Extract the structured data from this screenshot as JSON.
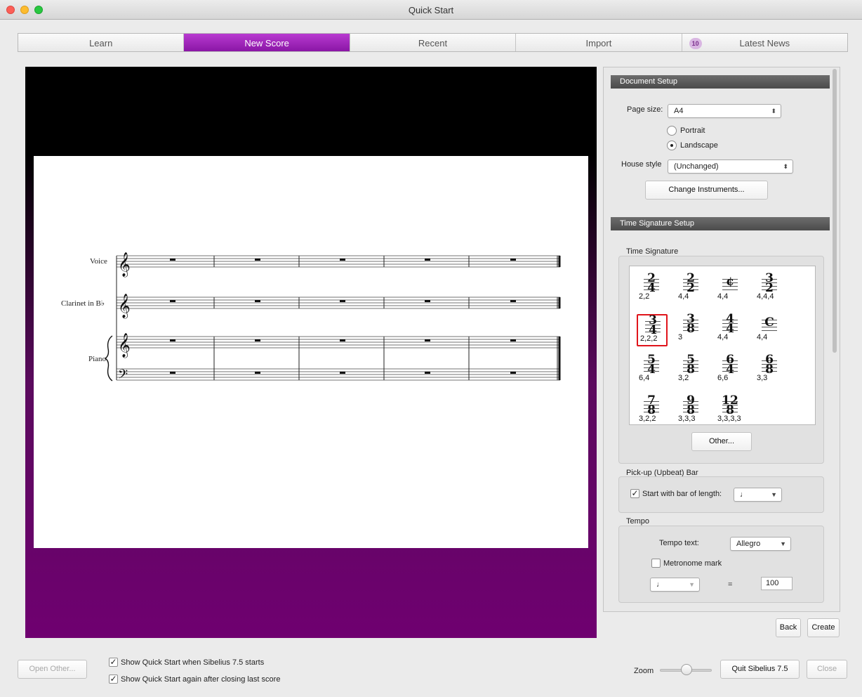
{
  "window": {
    "title": "Quick Start"
  },
  "tabs": [
    {
      "label": "Learn"
    },
    {
      "label": "New Score"
    },
    {
      "label": "Recent"
    },
    {
      "label": "Import"
    },
    {
      "label": "Latest News",
      "badge": "10"
    }
  ],
  "score": {
    "instruments": [
      "Voice",
      "Clarinet in B♭",
      "Piano"
    ]
  },
  "document_setup": {
    "heading": "Document Setup",
    "page_size_label": "Page size:",
    "page_size_value": "A4",
    "portrait_label": "Portrait",
    "landscape_label": "Landscape",
    "orientation_selected": "Landscape",
    "house_style_label": "House style",
    "house_style_value": "(Unchanged)",
    "change_instruments_label": "Change Instruments..."
  },
  "time_signature_setup": {
    "heading": "Time Signature Setup",
    "group_label": "Time Signature",
    "options": [
      {
        "num": "2",
        "den": "4",
        "beats": "2,2"
      },
      {
        "num": "2",
        "den": "2",
        "beats": "4,4"
      },
      {
        "num": "¢",
        "den": "",
        "beats": "4,4"
      },
      {
        "num": "3",
        "den": "2",
        "beats": "4,4,4"
      },
      {
        "num": "3",
        "den": "4",
        "beats": "2,2,2",
        "selected": true
      },
      {
        "num": "3",
        "den": "8",
        "beats": "3"
      },
      {
        "num": "4",
        "den": "4",
        "beats": "4,4"
      },
      {
        "num": "C",
        "den": "",
        "beats": "4,4"
      },
      {
        "num": "5",
        "den": "4",
        "beats": "6,4"
      },
      {
        "num": "5",
        "den": "8",
        "beats": "3,2"
      },
      {
        "num": "6",
        "den": "4",
        "beats": "6,6"
      },
      {
        "num": "6",
        "den": "8",
        "beats": "3,3"
      },
      {
        "num": "7",
        "den": "8",
        "beats": "3,2,2"
      },
      {
        "num": "9",
        "den": "8",
        "beats": "3,3,3"
      },
      {
        "num": "12",
        "den": "8",
        "beats": "3,3,3,3"
      }
    ],
    "other_button_label": "Other..."
  },
  "pickup": {
    "group_label": "Pick-up (Upbeat) Bar",
    "checkbox_label": "Start with bar of length:",
    "checked": true,
    "length_value": "♩"
  },
  "tempo": {
    "group_label": "Tempo",
    "tempo_text_label": "Tempo text:",
    "tempo_text_value": "Allegro",
    "metronome_label": "Metronome mark",
    "metronome_checked": false,
    "note_value": "♩",
    "equals": "=",
    "bpm": "100"
  },
  "actions": {
    "back_label": "Back",
    "create_label": "Create",
    "open_other_label": "Open Other...",
    "show_on_start_label": "Show Quick Start when Sibelius 7.5 starts",
    "show_after_close_label": "Show Quick Start again after closing last score",
    "zoom_label": "Zoom",
    "quit_label": "Quit Sibelius 7.5",
    "close_label": "Close"
  },
  "colors": {
    "accent": "#9a22b8",
    "preview_bottom": "#6f0070",
    "selected_border": "#e0141b"
  }
}
